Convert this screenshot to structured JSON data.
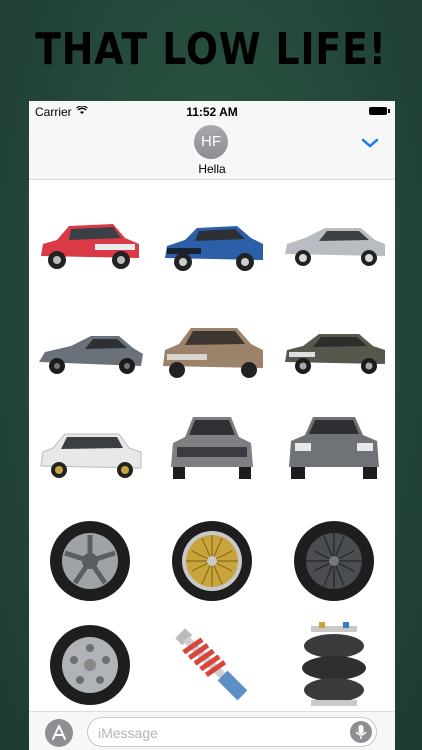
{
  "headline": "THAT LOW LIFE!",
  "status_bar": {
    "carrier": "Carrier",
    "time": "11:52 AM"
  },
  "header": {
    "avatar_initials": "HF",
    "contact_name": "Hella"
  },
  "composer": {
    "placeholder": "iMessage"
  },
  "colors": {
    "background": "#264a3b",
    "accent_blue": "#1d7fe8"
  },
  "stickers": [
    {
      "name": "red-hatchback-sticker",
      "color": "#d93a45"
    },
    {
      "name": "blue-coupe-sticker",
      "color": "#2b5fa8"
    },
    {
      "name": "silver-hatchback-sticker",
      "color": "#b9bcc0"
    },
    {
      "name": "gray-sports-car-sticker",
      "color": "#6b7178"
    },
    {
      "name": "bronze-sedan-sticker",
      "color": "#9c826a"
    },
    {
      "name": "dark-gray-sedan-sticker",
      "color": "#56584e"
    },
    {
      "name": "white-wagon-sticker",
      "color": "#e8e8e8"
    },
    {
      "name": "gray-sedan-front-sticker",
      "color": "#7d7f82"
    },
    {
      "name": "gray-sedan-rear-sticker",
      "color": "#6f7276"
    },
    {
      "name": "spoke-wheel-sticker",
      "color": "#9fa3a8"
    },
    {
      "name": "gold-mesh-wheel-sticker",
      "color": "#c9a43b"
    },
    {
      "name": "dark-mesh-wheel-sticker",
      "color": "#4a4d52"
    },
    {
      "name": "silver-wheel-sticker",
      "color": "#b0b3b7"
    },
    {
      "name": "coilover-sticker",
      "color": "#d9443b"
    },
    {
      "name": "air-suspension-sticker",
      "color": "#3a3b3d"
    }
  ]
}
